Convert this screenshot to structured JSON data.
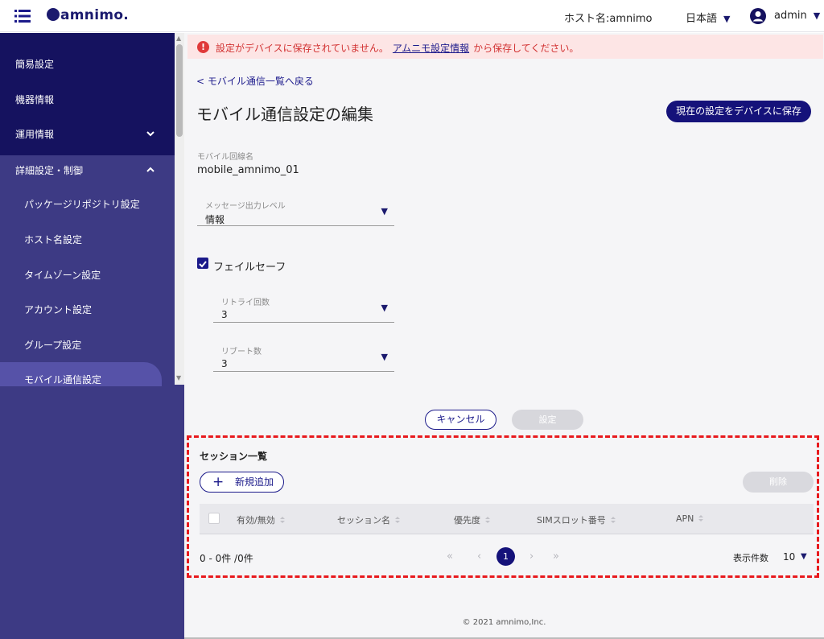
{
  "topbar": {
    "logo": "amnimo.",
    "hostname": "ホスト名:amnimo",
    "language": "日本語",
    "user": "admin"
  },
  "sidebar": {
    "items": [
      {
        "label": "簡易設定"
      },
      {
        "label": "機器情報"
      },
      {
        "label": "運用情報"
      },
      {
        "label": "詳細設定・制御"
      }
    ],
    "subitems": [
      {
        "label": "パッケージリポジトリ設定"
      },
      {
        "label": "ホスト名設定"
      },
      {
        "label": "タイムゾーン設定"
      },
      {
        "label": "アカウント設定"
      },
      {
        "label": "グループ設定"
      },
      {
        "label": "モバイル通信設定"
      }
    ]
  },
  "alert": {
    "before": "設定がデバイスに保存されていません。",
    "link": "アムニモ設定情報",
    "after": "から保存してください。"
  },
  "page": {
    "back": "< モバイル通信一覧へ戻る",
    "title": "モバイル通信設定の編集",
    "save_button": "現在の設定をデバイスに保存"
  },
  "form": {
    "line_name_label": "モバイル回線名",
    "line_name_value": "mobile_amnimo_01",
    "log_level_label": "メッセージ出力レベル",
    "log_level_value": "情報",
    "failsafe_label": "フェイルセーフ",
    "retry_label": "リトライ回数",
    "retry_value": "3",
    "reboot_label": "リブート数",
    "reboot_value": "3",
    "cancel": "キャンセル",
    "submit": "設定"
  },
  "sessions": {
    "title": "セッション一覧",
    "add": "新規追加",
    "delete": "削除",
    "columns": [
      "有効/無効",
      "セッション名",
      "優先度",
      "SIMスロット番号",
      "APN"
    ],
    "range": "0 - 0件 /0件",
    "current_page": "1",
    "per_page_label": "表示件数",
    "per_page_value": "10"
  },
  "footer": "© 2021 amnimo,Inc."
}
